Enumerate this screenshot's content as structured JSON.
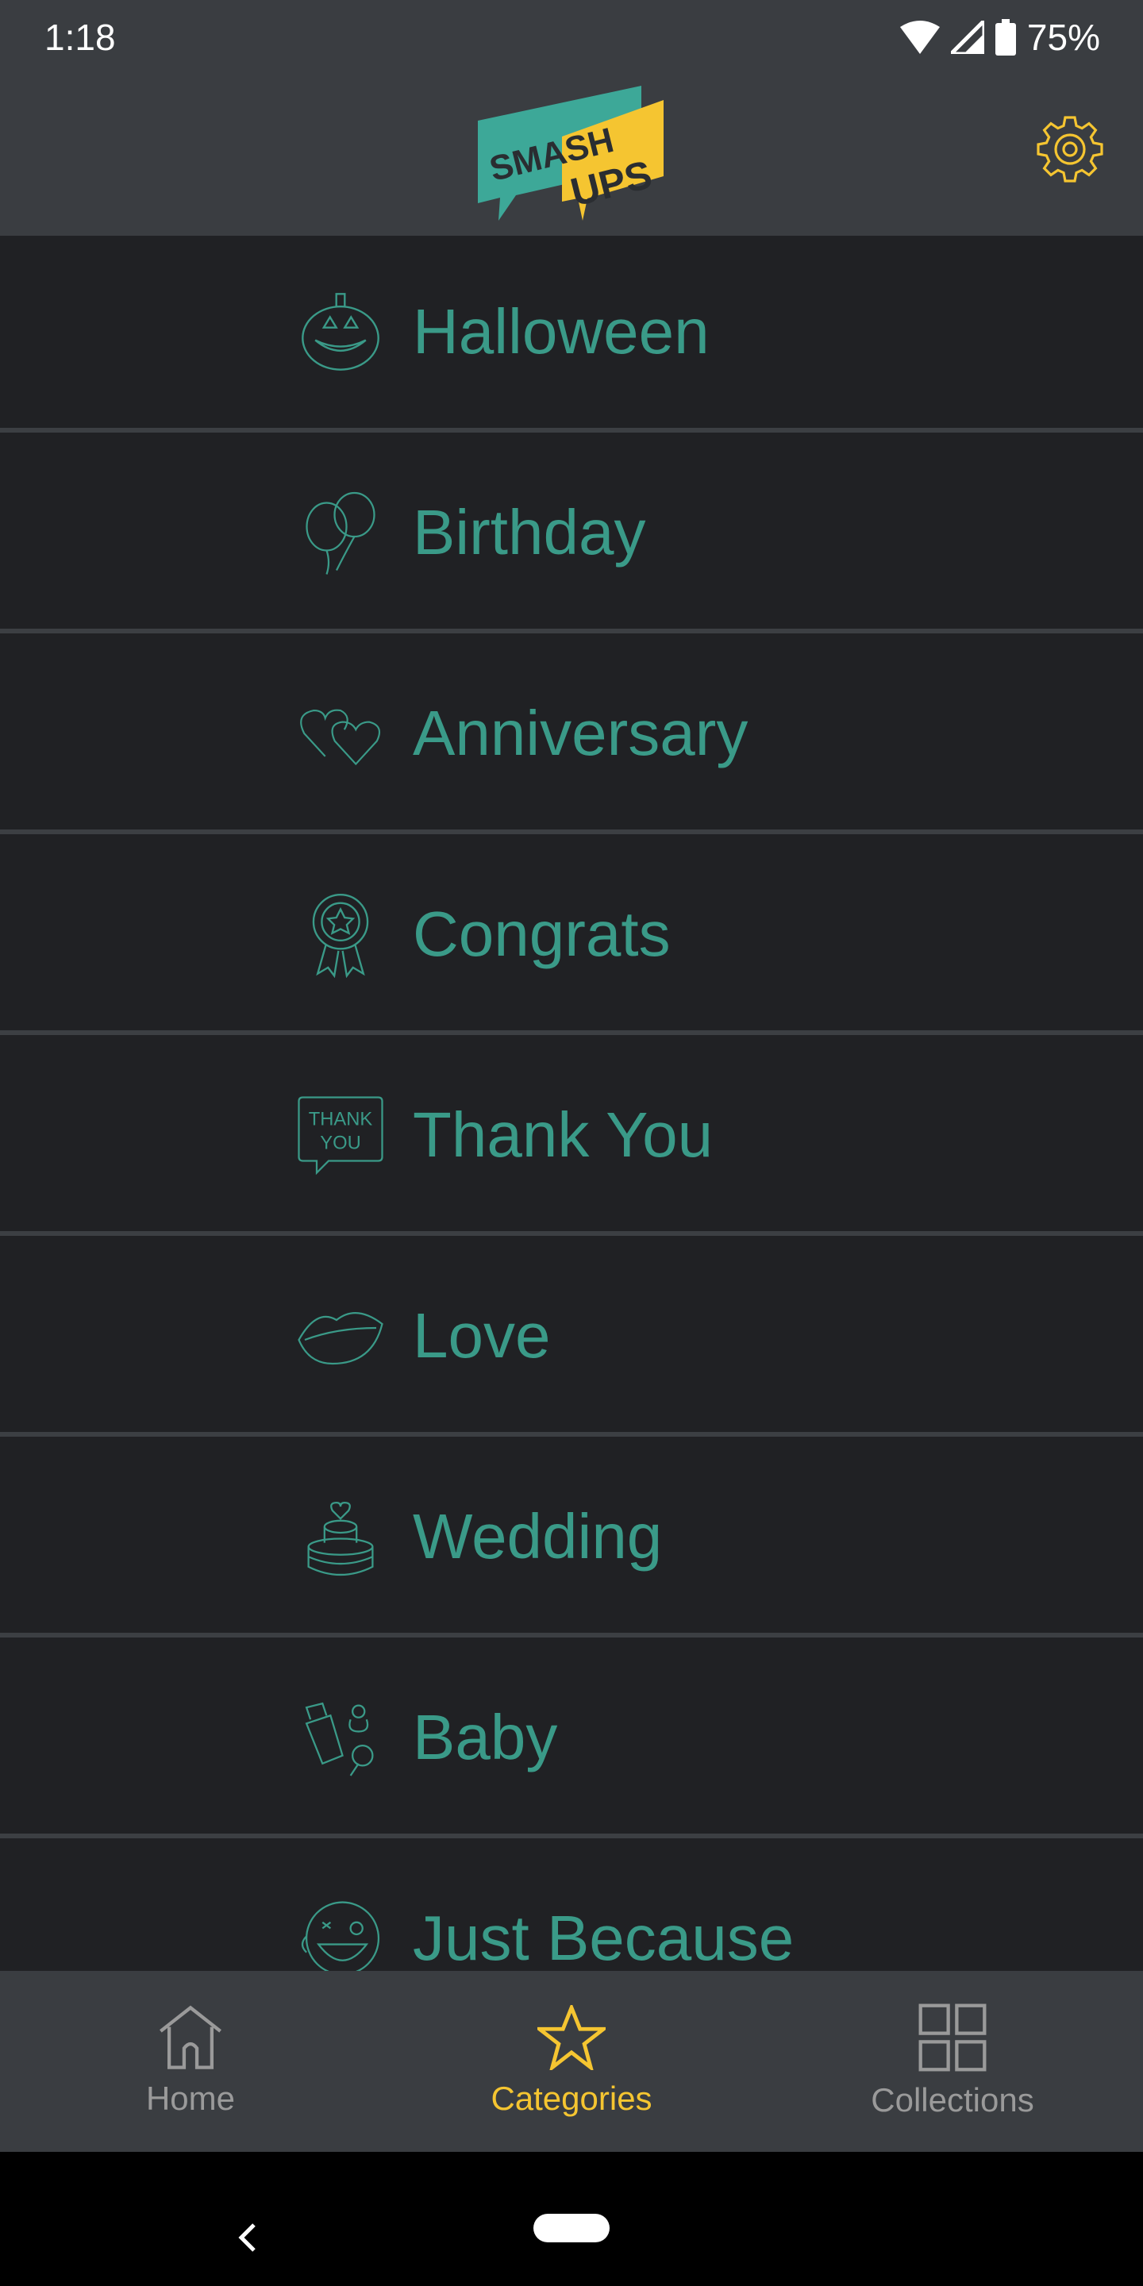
{
  "status_bar": {
    "time": "1:18",
    "battery": "75%"
  },
  "header": {
    "logo_line1": "SMASH",
    "logo_line2": "UPS",
    "settings_icon": "gear-icon"
  },
  "categories": [
    {
      "label": "Halloween",
      "icon": "pumpkin-icon"
    },
    {
      "label": "Birthday",
      "icon": "balloons-icon"
    },
    {
      "label": "Anniversary",
      "icon": "hearts-icon"
    },
    {
      "label": "Congrats",
      "icon": "award-ribbon-icon"
    },
    {
      "label": "Thank You",
      "icon": "thank-you-bubble-icon",
      "icon_text1": "THANK",
      "icon_text2": "YOU"
    },
    {
      "label": "Love",
      "icon": "lips-icon"
    },
    {
      "label": "Wedding",
      "icon": "wedding-cake-icon"
    },
    {
      "label": "Baby",
      "icon": "baby-bottle-icon"
    },
    {
      "label": "Just Because",
      "icon": "winking-face-icon"
    }
  ],
  "bottom_nav": [
    {
      "label": "Home",
      "icon": "home-icon"
    },
    {
      "label": "Categories",
      "icon": "star-icon",
      "active": true
    },
    {
      "label": "Collections",
      "icon": "grid-icon"
    }
  ],
  "colors": {
    "accent": "#3a9a88",
    "active": "#f5c531",
    "header": "#3a3d41",
    "background": "#202124"
  }
}
